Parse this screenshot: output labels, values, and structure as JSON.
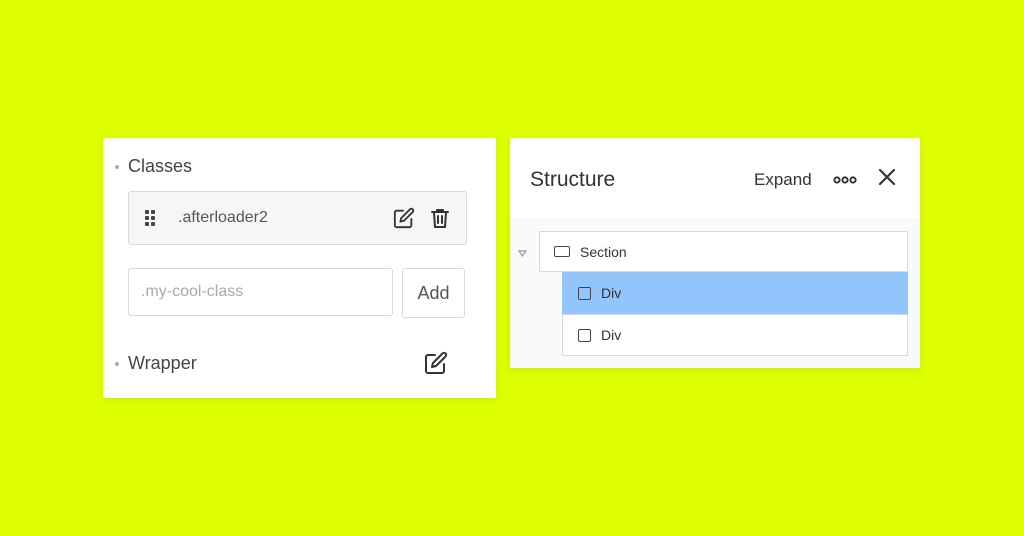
{
  "classes_panel": {
    "classes_label": "Classes",
    "existing_class": ".afterloader2",
    "input_placeholder": ".my-cool-class",
    "add_label": "Add",
    "wrapper_label": "Wrapper"
  },
  "structure_panel": {
    "title": "Structure",
    "expand_label": "Expand",
    "tree": {
      "section_label": "Section",
      "children": [
        {
          "label": "Div",
          "selected": true
        },
        {
          "label": "Div",
          "selected": false
        }
      ]
    }
  },
  "colors": {
    "background": "#ddff00",
    "selected_row": "#93c5fd"
  },
  "icons": [
    "drag-handle-icon",
    "edit-icon",
    "trash-icon",
    "more-icon",
    "close-icon",
    "caret-down-icon",
    "section-icon",
    "div-icon"
  ]
}
